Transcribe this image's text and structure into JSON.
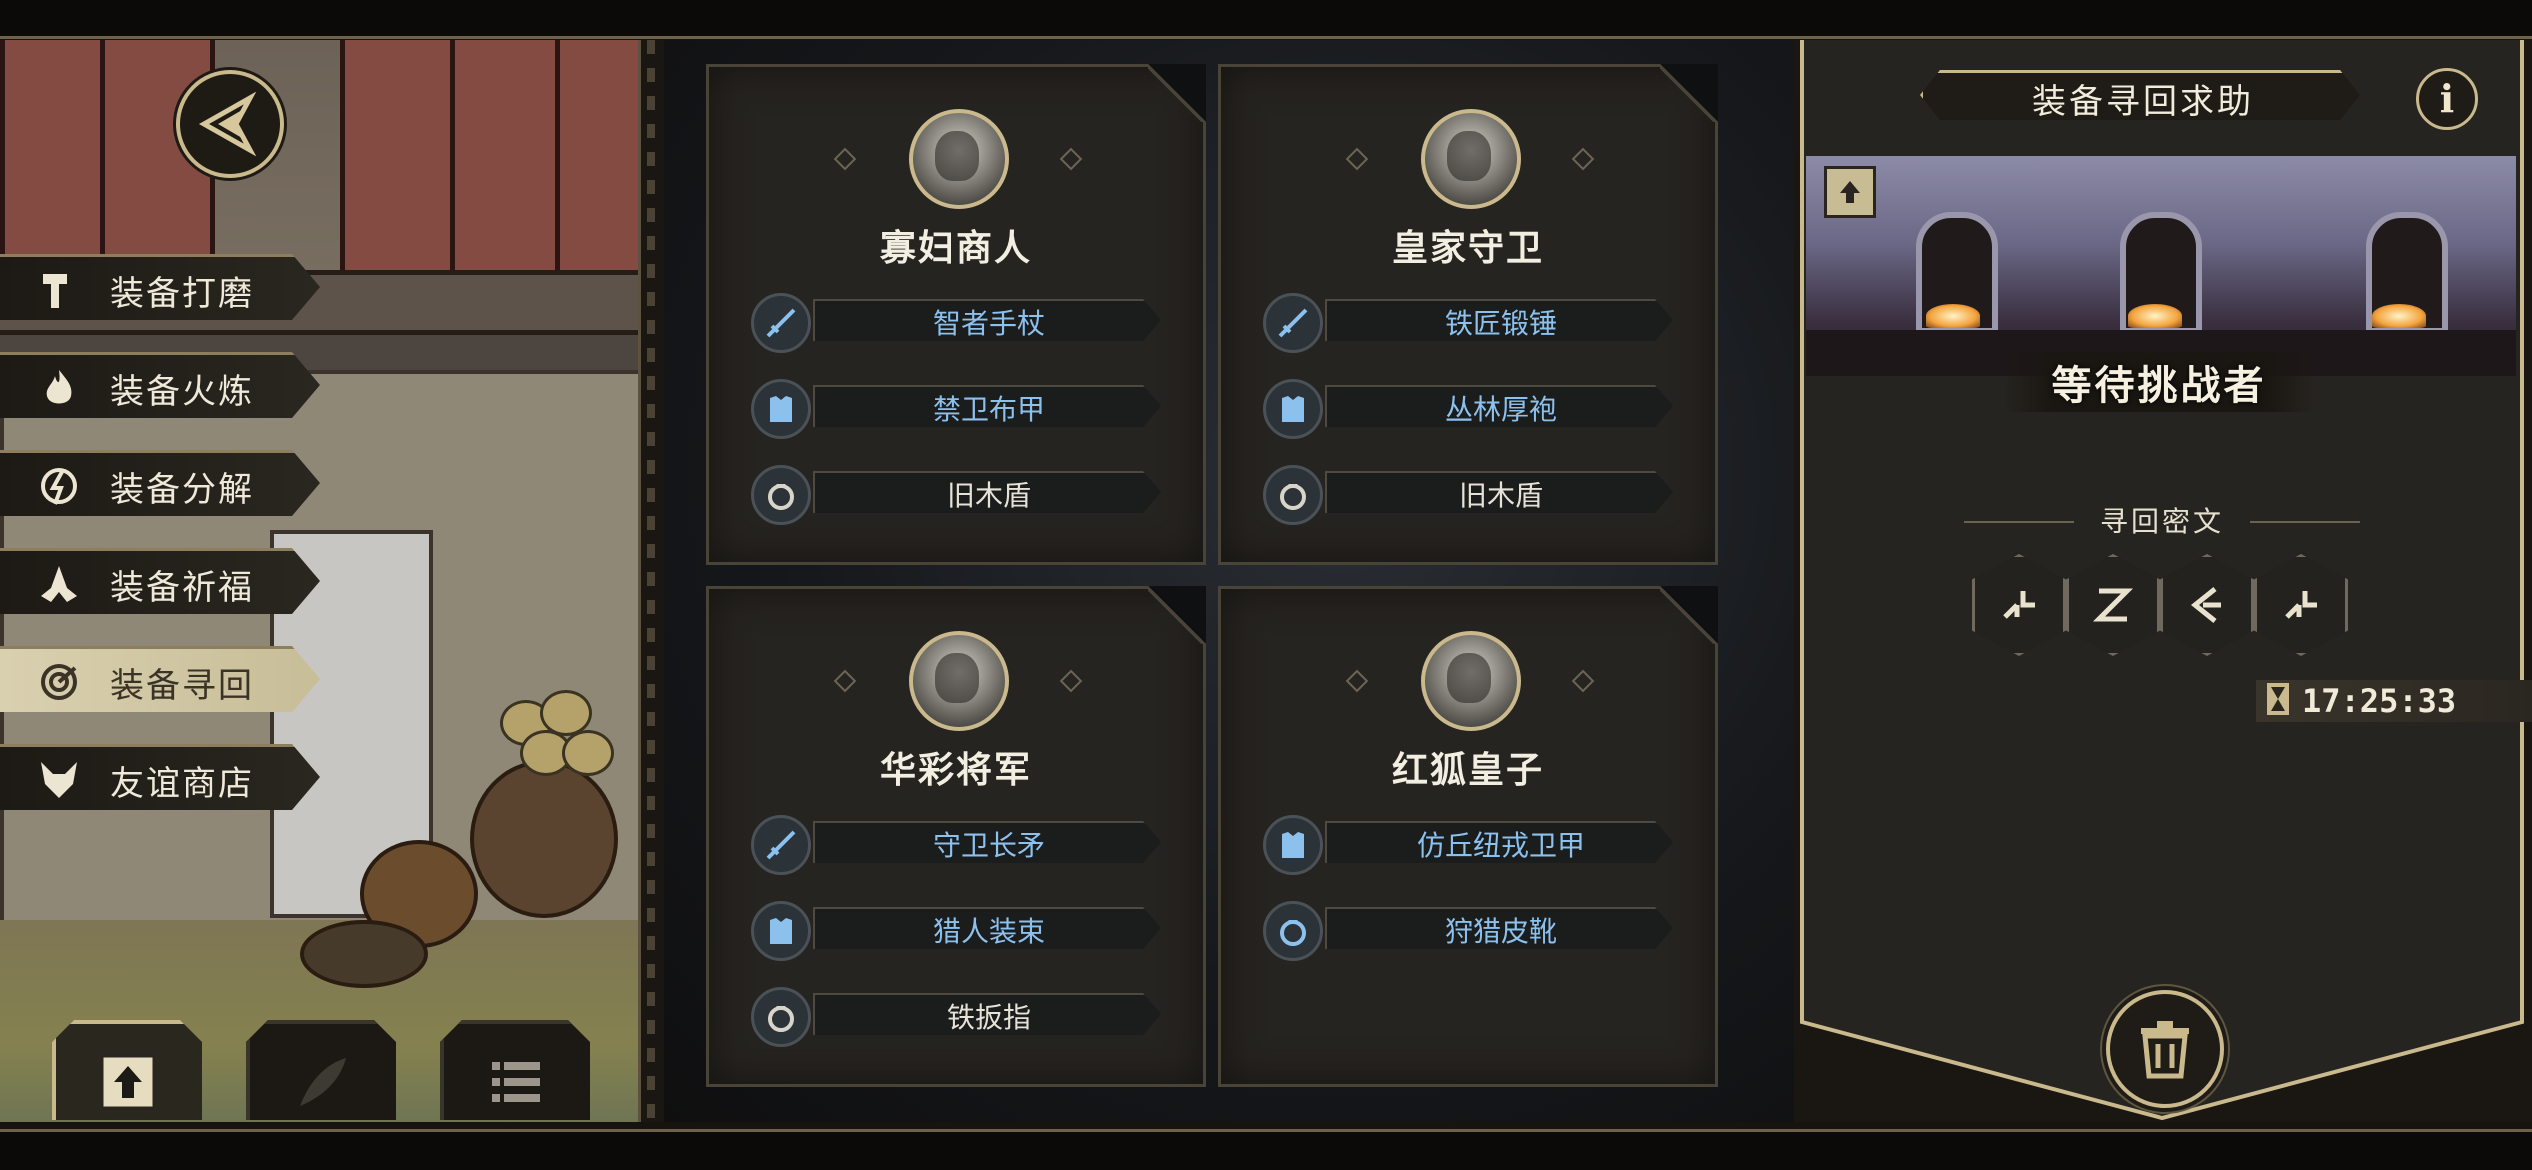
{
  "menu": {
    "items": [
      {
        "label": "装备打磨",
        "icon": "hammer-icon"
      },
      {
        "label": "装备火炼",
        "icon": "flame-icon"
      },
      {
        "label": "装备分解",
        "icon": "disassemble-icon"
      },
      {
        "label": "装备祈福",
        "icon": "pray-hands-icon"
      },
      {
        "label": "装备寻回",
        "icon": "target-icon",
        "active": true
      },
      {
        "label": "友谊商店",
        "icon": "fox-icon"
      }
    ]
  },
  "bottom_tabs": [
    {
      "icon": "upload-icon",
      "selected": true
    },
    {
      "icon": "feather-icon",
      "selected": false
    },
    {
      "icon": "list-icon",
      "selected": false
    }
  ],
  "cards": [
    {
      "name": "寡妇商人",
      "slots": [
        {
          "label": "智者手杖",
          "type": "weapon",
          "color": "blue"
        },
        {
          "label": "禁卫布甲",
          "type": "armor",
          "color": "blue"
        },
        {
          "label": "旧木盾",
          "type": "accessory",
          "color": "white"
        }
      ]
    },
    {
      "name": "皇家守卫",
      "slots": [
        {
          "label": "铁匠锻锤",
          "type": "weapon",
          "color": "blue"
        },
        {
          "label": "丛林厚袍",
          "type": "armor",
          "color": "blue"
        },
        {
          "label": "旧木盾",
          "type": "accessory",
          "color": "white"
        }
      ]
    },
    {
      "name": "华彩将军",
      "slots": [
        {
          "label": "守卫长矛",
          "type": "weapon",
          "color": "blue"
        },
        {
          "label": "猎人装束",
          "type": "armor",
          "color": "blue"
        },
        {
          "label": "铁扳指",
          "type": "accessory",
          "color": "white"
        }
      ]
    },
    {
      "name": "红狐皇子",
      "slots": [
        {
          "label": "仿丘纽戎卫甲",
          "type": "armor",
          "color": "blue"
        },
        {
          "label": "狩猎皮靴",
          "type": "accessory",
          "color": "blue"
        }
      ]
    }
  ],
  "panel": {
    "title": "装备寻回求助",
    "info_label": "i",
    "status": "等待挑战者",
    "rune_title": "寻回密文",
    "runes": [
      "rune-1-icon",
      "rune-2-icon",
      "rune-3-icon",
      "rune-1-icon"
    ],
    "timer": "17:25:33"
  },
  "colors": {
    "gold": "#c9b98d",
    "blue_text": "#8cc1ee",
    "white_text": "#e6e2d8",
    "panel_bg": "#262420"
  }
}
